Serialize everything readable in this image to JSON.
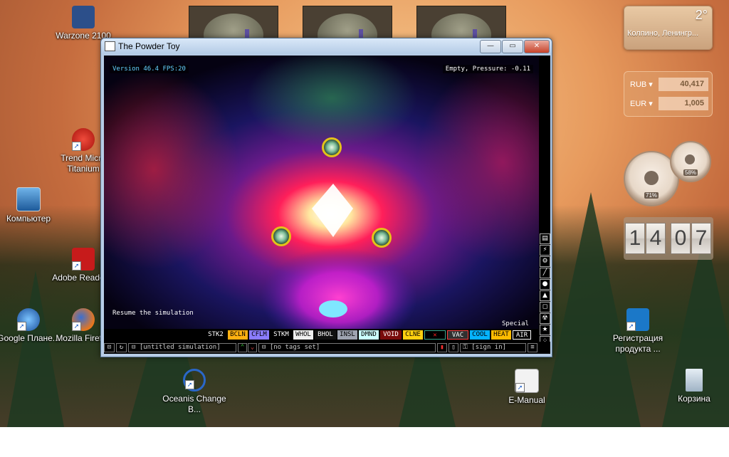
{
  "desktop": {
    "icons": [
      {
        "name": "warzone-icon",
        "label": "Warzone 2100"
      },
      {
        "name": "trend-micro-icon",
        "label": "Trend Micro Titanium"
      },
      {
        "name": "computer-icon",
        "label": "Компьютер"
      },
      {
        "name": "adobe-reader-icon",
        "label": "Adobe Reader 9"
      },
      {
        "name": "google-earth-icon",
        "label": "Google Плане..."
      },
      {
        "name": "firefox-icon",
        "label": "Mozilla Firefox"
      },
      {
        "name": "oceanis-icon",
        "label": "Oceanis Change B..."
      },
      {
        "name": "e-manual-icon",
        "label": "E-Manual"
      },
      {
        "name": "registration-icon",
        "label": "Регистрация продукта ..."
      },
      {
        "name": "recycle-bin-icon",
        "label": "Корзина"
      }
    ]
  },
  "gadgets": {
    "weather": {
      "temp": "2°",
      "place": "Колпино, Ленингр..."
    },
    "currency": [
      {
        "code": "RUB ▾",
        "value": "40,417"
      },
      {
        "code": "EUR ▾",
        "value": "1,005"
      }
    ],
    "meters": {
      "cpu": "71%",
      "memory": "58%"
    },
    "clock": {
      "digits": [
        "1",
        "4",
        "0",
        "7"
      ]
    }
  },
  "window": {
    "title": "The Powder Toy",
    "buttons": {
      "minimize": "—",
      "maximize": "▭",
      "close": "✕"
    }
  },
  "sim": {
    "version": "Version 46.4 FPS:20",
    "status": "Empty, Pressure: -0.11",
    "hint": "Resume the simulation"
  },
  "elements": {
    "category_label": "Special",
    "items": [
      {
        "label": "STK2",
        "bg": "#000000",
        "fg": "#ffffff"
      },
      {
        "label": "BCLN",
        "bg": "#ffb011",
        "fg": "#000000"
      },
      {
        "label": "CFLM",
        "bg": "#8a7cff",
        "fg": "#000000"
      },
      {
        "label": "STKM",
        "bg": "#000000",
        "fg": "#ffffff"
      },
      {
        "label": "WHOL",
        "bg": "#efefef",
        "fg": "#000000"
      },
      {
        "label": "BHOL",
        "bg": "#101010",
        "fg": "#ffffff"
      },
      {
        "label": "INSL",
        "bg": "#9ea3b0",
        "fg": "#000000"
      },
      {
        "label": "DMND",
        "bg": "#ccffff",
        "fg": "#000000"
      },
      {
        "label": "VOID",
        "bg": "#790b0b",
        "fg": "#ffffff"
      },
      {
        "label": "CLNE",
        "bg": "#ffd010",
        "fg": "#000000"
      },
      {
        "label": "✕",
        "bg": "#000000",
        "fg": "#ff2020"
      },
      {
        "label": "VAC",
        "bg": "#303030",
        "fg": "#ffffff"
      },
      {
        "label": "COOL",
        "bg": "#05b2ff",
        "fg": "#000000"
      },
      {
        "label": "HEAT",
        "bg": "#ffbb00",
        "fg": "#000000"
      },
      {
        "label": "AIR",
        "bg": "#000000",
        "fg": "#ffffff"
      }
    ]
  },
  "bottombar": {
    "sim_name": "[untitled simulation]",
    "tags": "[no tags set]",
    "signin": "[sign in]"
  }
}
